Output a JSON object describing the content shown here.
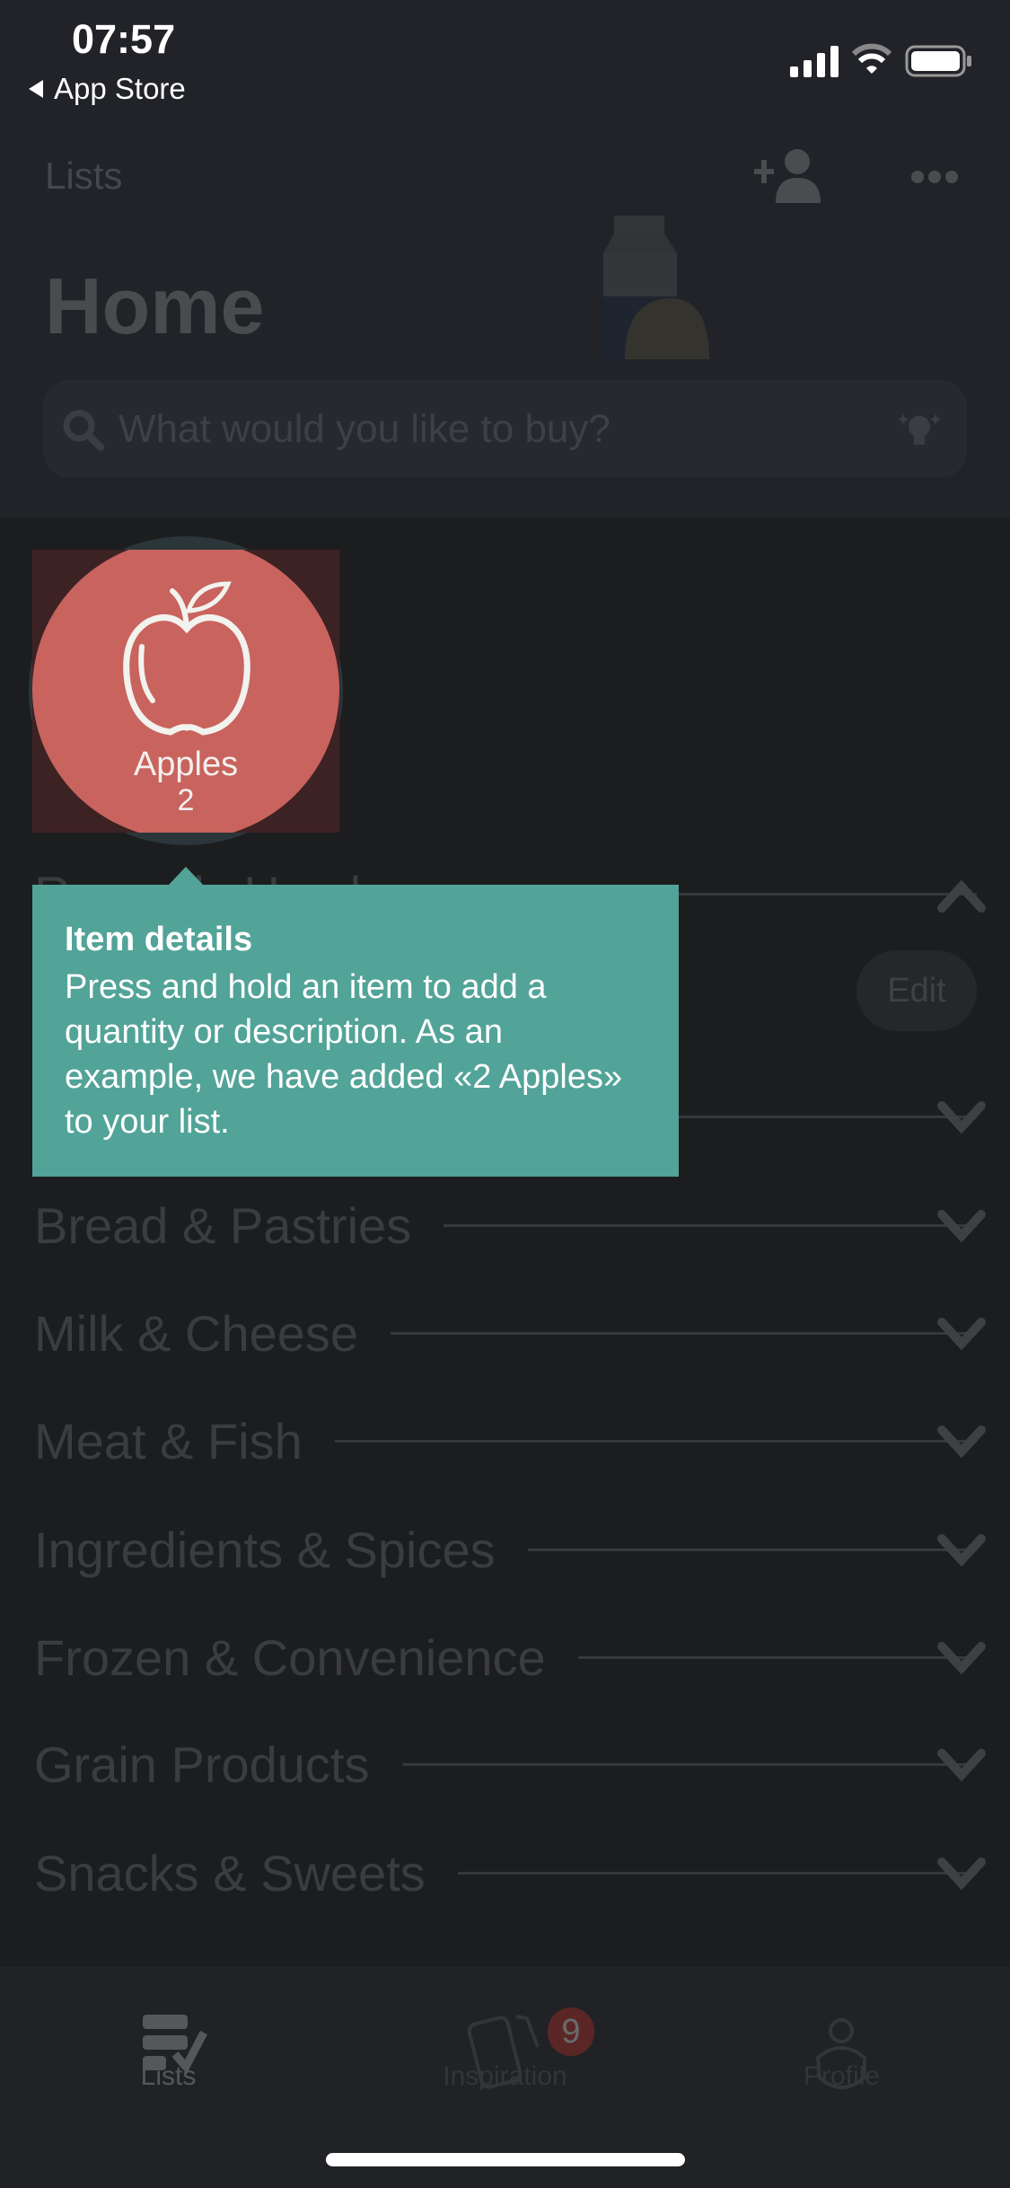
{
  "status_bar": {
    "time": "07:57",
    "back_label": "App Store",
    "icons": [
      "cellular-signal-icon",
      "wifi-icon",
      "battery-icon"
    ]
  },
  "header": {
    "nav_title": "Lists",
    "title": "Home",
    "search_placeholder": "What would you like to buy?",
    "icons": [
      "add-person-icon",
      "more-icon",
      "search-icon",
      "lightbulb-icon"
    ]
  },
  "item": {
    "name": "Apples",
    "quantity": "2",
    "color": "#c9635e"
  },
  "tooltip": {
    "title": "Item details",
    "body": "Press and hold an item to add a quantity or description. As an example, we have added «2 Apples» to your list.",
    "color": "#52a398"
  },
  "edit_label": "Edit",
  "categories": [
    {
      "label": "Recently Used",
      "expanded": true
    },
    {
      "label": "",
      "expanded": false
    },
    {
      "label": "Bread & Pastries",
      "expanded": false
    },
    {
      "label": "Milk & Cheese",
      "expanded": false
    },
    {
      "label": "Meat & Fish",
      "expanded": false
    },
    {
      "label": "Ingredients & Spices",
      "expanded": false
    },
    {
      "label": "Frozen & Convenience",
      "expanded": false
    },
    {
      "label": "Grain Products",
      "expanded": false
    },
    {
      "label": "Snacks & Sweets",
      "expanded": false
    }
  ],
  "tabbar": {
    "tabs": [
      {
        "label": "Lists",
        "icon": "list-check-icon",
        "active": true
      },
      {
        "label": "Inspiration",
        "icon": "cards-icon",
        "badge": "9"
      },
      {
        "label": "Profile",
        "icon": "person-icon"
      }
    ]
  }
}
